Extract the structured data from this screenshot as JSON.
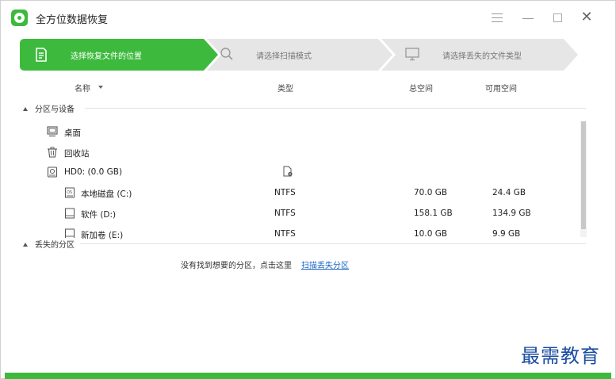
{
  "app": {
    "title": "全方位数据恢复"
  },
  "steps": [
    {
      "label": "选择恢复文件的位置",
      "icon": "document-icon",
      "active": true
    },
    {
      "label": "请选择扫描模式",
      "icon": "search-icon",
      "active": false
    },
    {
      "label": "请选择丢失的文件类型",
      "icon": "monitor-icon",
      "active": false
    }
  ],
  "columns": {
    "name": "名称",
    "type": "类型",
    "total": "总空间",
    "free": "可用空间"
  },
  "sections": {
    "devices": "分区与设备",
    "lost": "丢失的分区"
  },
  "items": [
    {
      "name": "桌面",
      "icon": "desktop-icon",
      "type": "",
      "total": "",
      "free": ""
    },
    {
      "name": "回收站",
      "icon": "trash-icon",
      "type": "",
      "total": "",
      "free": ""
    },
    {
      "name": "HD0:  (0.0 GB)",
      "icon": "hard-disk-icon",
      "type": "",
      "total": "",
      "free": ""
    },
    {
      "name": "本地磁盘 (C:)",
      "icon": "os-drive-icon",
      "type": "NTFS",
      "total": "70.0 GB",
      "free": "24.4 GB"
    },
    {
      "name": "软件 (D:)",
      "icon": "drive-icon",
      "type": "NTFS",
      "total": "158.1 GB",
      "free": "134.9 GB"
    },
    {
      "name": "新加卷 (E:)",
      "icon": "drive-icon",
      "type": "NTFS",
      "total": "10.0 GB",
      "free": "9.9 GB"
    }
  ],
  "lost_partition": {
    "message": "没有找到想要的分区，点击这里",
    "link": "扫描丢失分区"
  },
  "watermark": "最需教育",
  "colors": {
    "accent": "#3dba3d",
    "link": "#1a66c4",
    "step_inactive": "#e6e6e6"
  }
}
